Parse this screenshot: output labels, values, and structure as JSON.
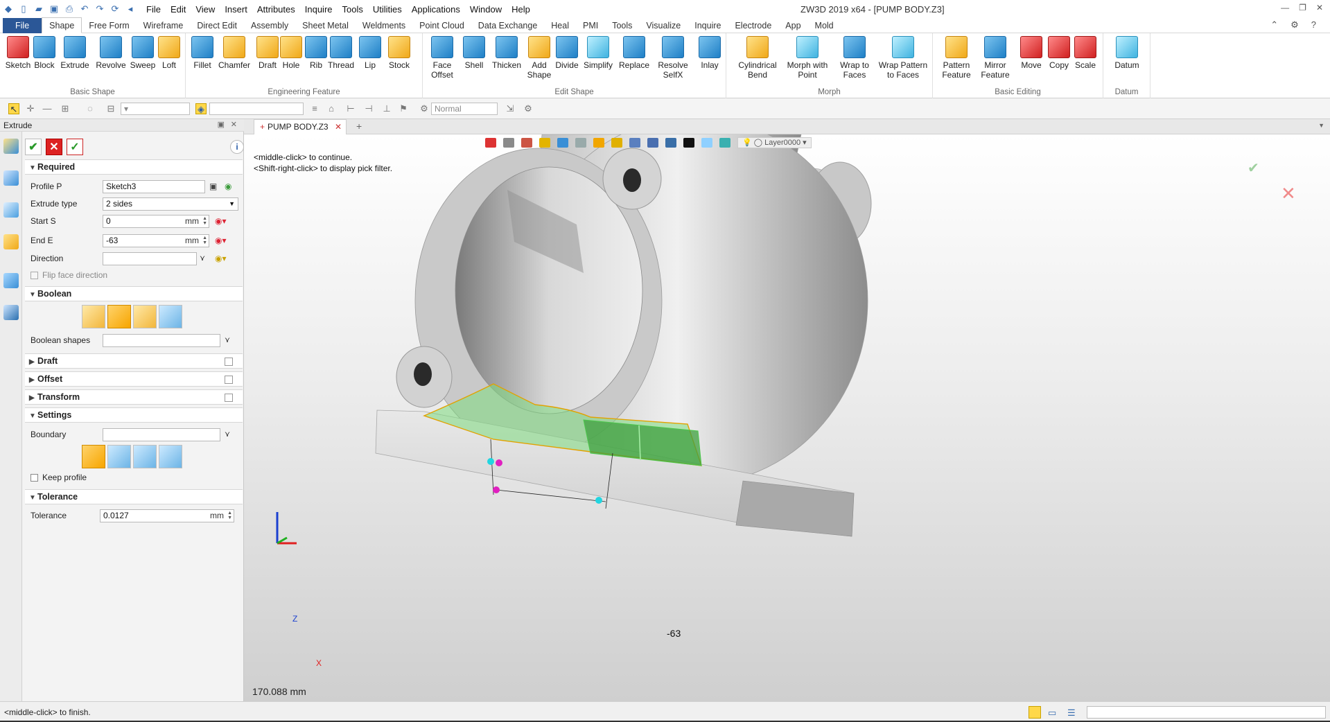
{
  "menubar": {
    "items": [
      "File",
      "Edit",
      "View",
      "Insert",
      "Attributes",
      "Inquire",
      "Tools",
      "Utilities",
      "Applications",
      "Window",
      "Help"
    ]
  },
  "title": "ZW3D 2019  x64 - [PUMP BODY.Z3]",
  "ribbon_tabs": [
    "File",
    "Shape",
    "Free Form",
    "Wireframe",
    "Direct Edit",
    "Assembly",
    "Sheet Metal",
    "Weldments",
    "Point Cloud",
    "Data Exchange",
    "Heal",
    "PMI",
    "Tools",
    "Visualize",
    "Inquire",
    "Electrode",
    "App",
    "Mold"
  ],
  "ribbon": {
    "basic_shape": {
      "label": "Basic Shape",
      "items": [
        "Sketch",
        "Block",
        "Extrude",
        "Revolve",
        "Sweep",
        "Loft"
      ]
    },
    "engineering_feature": {
      "label": "Engineering Feature",
      "items": [
        "Fillet",
        "Chamfer",
        "Draft",
        "Hole",
        "Rib",
        "Thread",
        "Lip",
        "Stock"
      ]
    },
    "edit_shape": {
      "label": "Edit Shape",
      "items": [
        "Face\nOffset",
        "Shell",
        "Thicken",
        "Add\nShape",
        "Divide",
        "Simplify",
        "Replace",
        "Resolve\nSelfX",
        "Inlay"
      ]
    },
    "morph": {
      "label": "Morph",
      "items": [
        "Cylindrical\nBend",
        "Morph with\nPoint",
        "Wrap to\nFaces",
        "Wrap Pattern\nto Faces"
      ]
    },
    "basic_editing": {
      "label": "Basic Editing",
      "items": [
        "Pattern\nFeature",
        "Mirror\nFeature",
        "Move",
        "Copy",
        "Scale"
      ]
    },
    "datum": {
      "label": "Datum",
      "items": [
        "Datum"
      ]
    }
  },
  "toolbar2": {
    "style_combo": "Normal"
  },
  "panel": {
    "title": "Extrude",
    "required": {
      "header": "Required",
      "profile_label": "Profile P",
      "profile_value": "Sketch3",
      "extrude_type_label": "Extrude type",
      "extrude_type_value": "2 sides",
      "start_label": "Start S",
      "start_value": "0",
      "start_unit": "mm",
      "end_label": "End E",
      "end_value": "-63",
      "end_unit": "mm",
      "direction_label": "Direction",
      "flip_label": "Flip face direction"
    },
    "boolean": {
      "header": "Boolean",
      "shapes_label": "Boolean shapes"
    },
    "draft": {
      "header": "Draft"
    },
    "offset": {
      "header": "Offset"
    },
    "transform": {
      "header": "Transform"
    },
    "settings": {
      "header": "Settings",
      "boundary_label": "Boundary",
      "keep_profile_label": "Keep profile"
    },
    "tolerance": {
      "header": "Tolerance",
      "label": "Tolerance",
      "value": "0.0127",
      "unit": "mm"
    }
  },
  "document_tab": "PUMP BODY.Z3",
  "viewport": {
    "prompt_1": "<middle-click> to continue.",
    "prompt_2": "<Shift-right-click> to display pick filter.",
    "layer": "Layer0000",
    "dimension": "-63",
    "readout": "170.088 mm",
    "axis_z": "Z",
    "axis_x": "X"
  },
  "status": {
    "text": "<middle-click> to finish."
  }
}
